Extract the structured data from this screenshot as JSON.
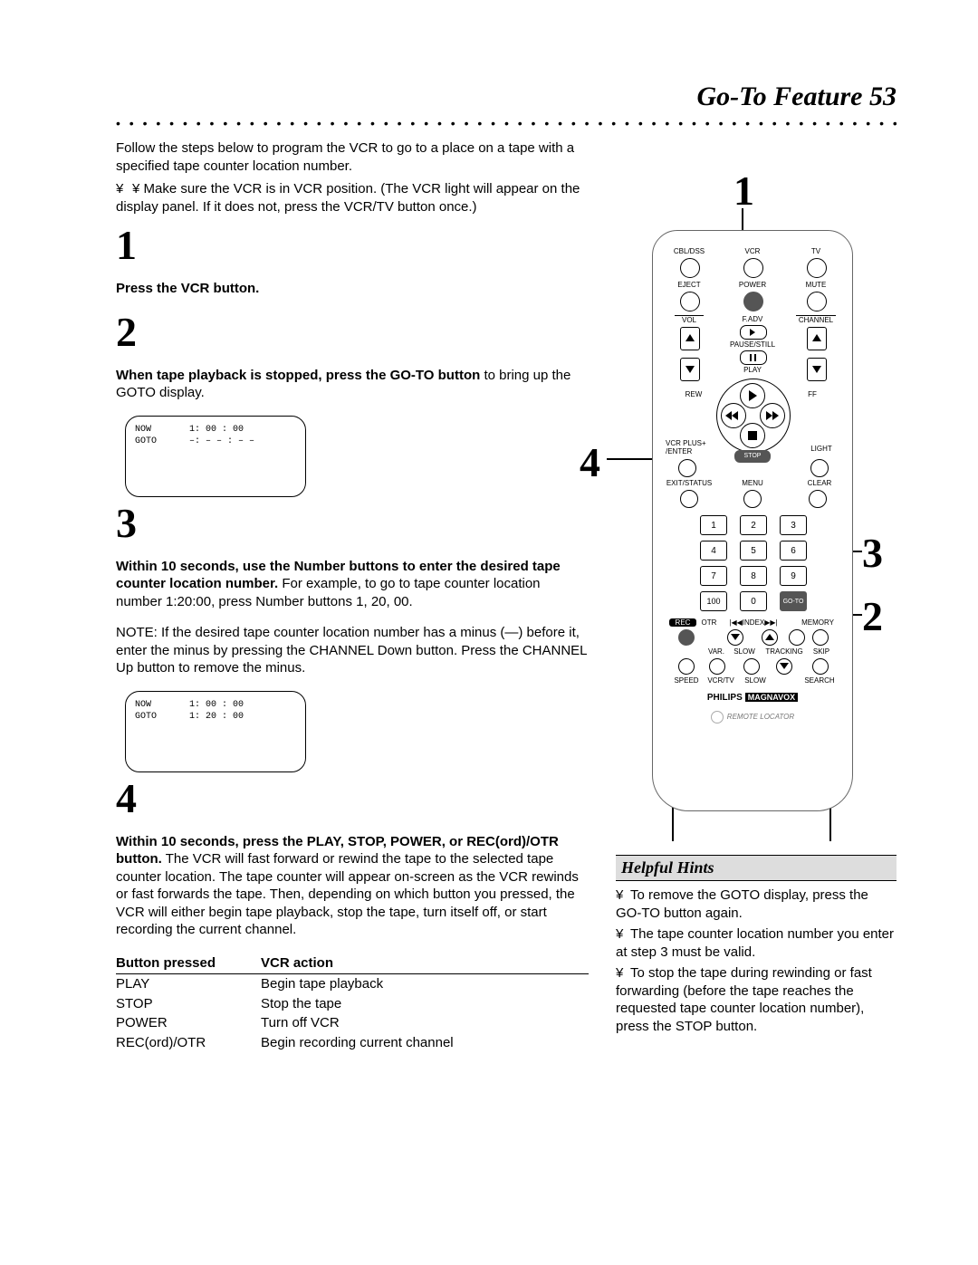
{
  "header": {
    "title": "Go-To Feature  53"
  },
  "intro": "Follow the steps below to program the VCR to go to a place on a tape with a specified tape counter location number.",
  "bullet_pre": "¥ Make sure the VCR is in VCR position. (The VCR light will appear on the display panel. If it does not, press the VCR/TV button once.)",
  "steps": {
    "s1": {
      "num": "1",
      "bold": "Press the VCR button."
    },
    "s2": {
      "num": "2",
      "bold": "When tape playback is stopped, press the GO-TO button",
      "rest": " to bring up the GOTO display."
    },
    "s3": {
      "num": "3",
      "bold": "Within 10 seconds, use the Number buttons to enter the desired tape counter location number.",
      "rest": " For example, to go to tape counter location number 1:20:00, press Number buttons 1, 20, 00.",
      "note": "NOTE: If the desired tape counter location number has a minus (—) before it, enter the minus by pressing the CHANNEL Down button. Press the CHANNEL Up button to remove the minus."
    },
    "s4": {
      "num": "4",
      "bold": "Within 10 seconds, press the PLAY, STOP, POWER, or REC(ord)/OTR button.",
      "rest": " The VCR will fast forward or rewind the tape to the selected tape counter location. The tape counter will appear on-screen as the VCR rewinds or fast forwards the tape. Then, depending on which button you pressed, the VCR will either begin tape playback, stop the tape, turn itself off, or start recording the current channel."
    }
  },
  "screen1": {
    "now_label": "NOW",
    "now_val": "1: 00 : 00",
    "goto_label": "GOTO",
    "goto_val": "–: – – : – –"
  },
  "screen2": {
    "now_label": "NOW",
    "now_val": "1: 00 : 00",
    "goto_label": "GOTO",
    "goto_val": "1: 20 : 00"
  },
  "table": {
    "h1": "Button pressed",
    "h2": "VCR action",
    "rows": [
      {
        "a": "PLAY",
        "b": "Begin tape playback"
      },
      {
        "a": "STOP",
        "b": "Stop the tape"
      },
      {
        "a": "POWER",
        "b": "Turn off VCR"
      },
      {
        "a": "REC(ord)/OTR",
        "b": "Begin recording current channel"
      }
    ]
  },
  "callouts": {
    "c1": "1",
    "c2": "2",
    "c3": "3",
    "c4": "4"
  },
  "remote": {
    "row1": {
      "a": "CBL/DSS",
      "b": "VCR",
      "c": "TV"
    },
    "row2": {
      "a": "EJECT",
      "b": "POWER",
      "c": "MUTE"
    },
    "vol": "VOL",
    "fadv": "F.ADV",
    "channel": "CHANNEL",
    "pause": "PAUSE/STILL",
    "play": "PLAY",
    "rew": "REW",
    "ff": "FF",
    "vcrplus": "VCR PLUS+",
    "enter": "/ENTER",
    "stop": "STOP",
    "light": "LIGHT",
    "exit": "EXIT/STATUS",
    "menu": "MENU",
    "clear": "CLEAR",
    "nums": [
      "1",
      "2",
      "3",
      "4",
      "5",
      "6",
      "7",
      "8",
      "9",
      "100",
      "0",
      "GO-TO"
    ],
    "brow": {
      "rec": "REC",
      "otr": "OTR",
      "index": "INDEX",
      "memory": "MEMORY"
    },
    "crow": {
      "var": "VAR.",
      "slow": "SLOW",
      "tracking": "TRACKING",
      "skip": "SKIP"
    },
    "drow": {
      "speed": "SPEED",
      "vcrtv": "VCR/TV",
      "slow": "SLOW",
      "search": "SEARCH"
    },
    "brand1": "PHILIPS",
    "brand2": "MAGNAVOX",
    "locator": "REMOTE LOCATOR"
  },
  "hints": {
    "title": "Helpful Hints",
    "items": [
      "To remove the GOTO display, press the GO-TO button again.",
      "The tape counter location number you enter at step 3 must be valid.",
      "To stop the tape during rewinding or fast forwarding (before the tape reaches the requested tape counter location number), press the STOP button."
    ]
  }
}
